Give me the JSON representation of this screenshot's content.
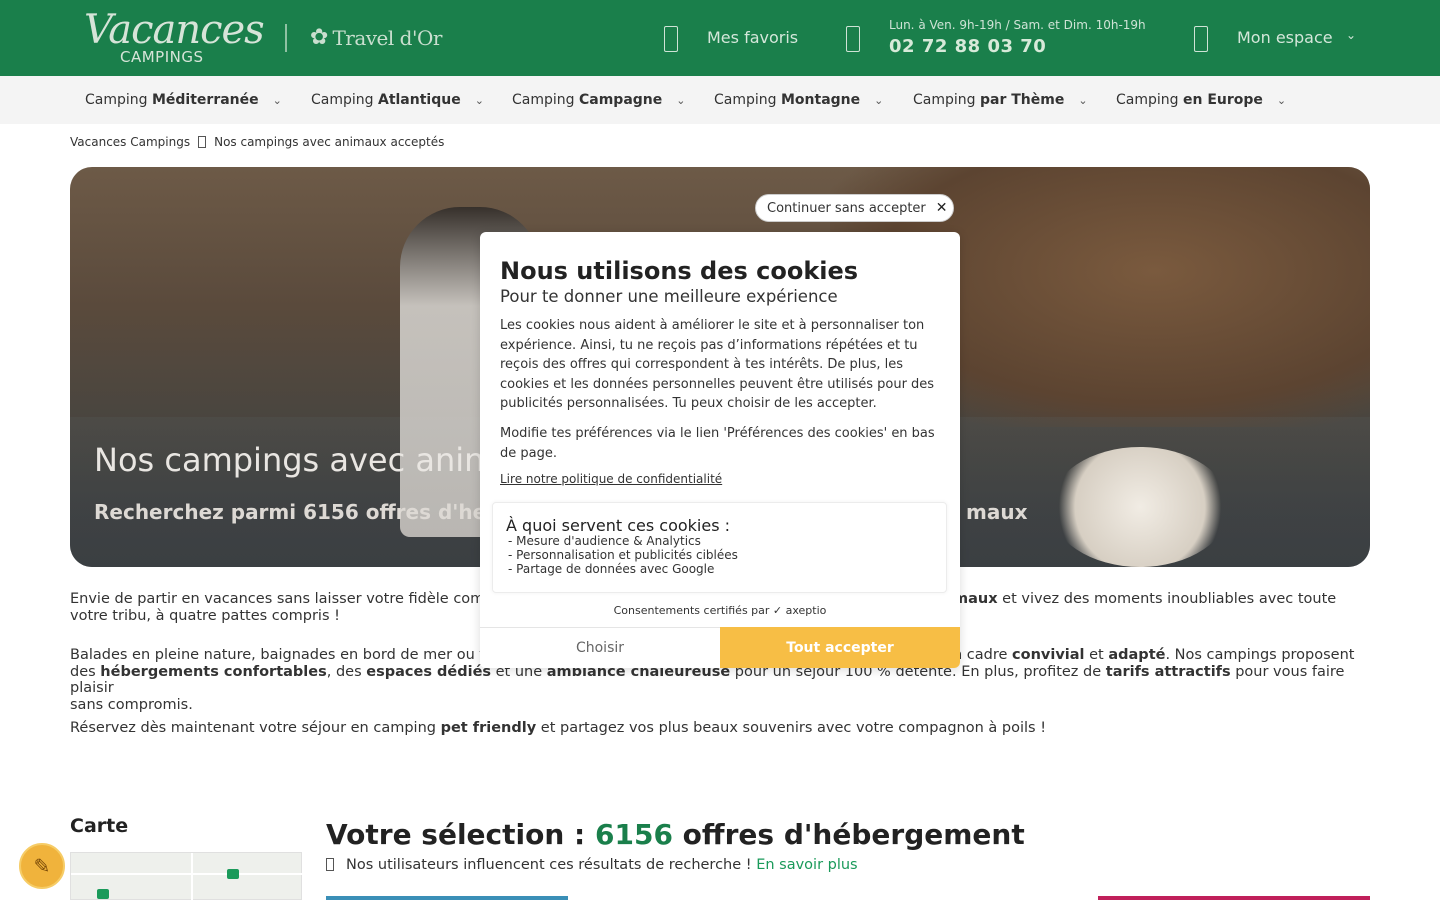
{
  "header": {
    "logo_main": "Vacances",
    "logo_sub": "CAMPINGS",
    "partner_logo": "Travel d'Or",
    "favorites_label": "Mes favoris",
    "hours": "Lun. à Ven. 9h-19h / Sam. et Dim. 10h-19h",
    "phone": "02 72 88 03 70",
    "account_label": "Mon espace",
    "bg_color": "#1a7f4b"
  },
  "nav": [
    {
      "prefix": "Camping",
      "bold": "Méditerranée"
    },
    {
      "prefix": "Camping",
      "bold": "Atlantique"
    },
    {
      "prefix": "Camping",
      "bold": "Campagne"
    },
    {
      "prefix": "Camping",
      "bold": "Montagne"
    },
    {
      "prefix": "Camping",
      "bold": "par Thème"
    },
    {
      "prefix": "Camping",
      "bold": "en Europe"
    }
  ],
  "breadcrumb": {
    "home": "Vacances Campings",
    "current": "Nos campings avec animaux acceptés"
  },
  "hero": {
    "title": "Nos campings avec anin",
    "subtitle": "Recherchez parmi 6156 offres d'he",
    "subtitle_end": "maux"
  },
  "intro": {
    "p1_a": "Envie de partir en vacances sans laisser votre fidèle comp",
    "p1_bold": "maux",
    "p1_b": " et vivez des moments inoubliables avec toute",
    "p1_c": "votre tribu, à quatre pattes compris !",
    "p2_a": "Balades en pleine nature, baignades en bord de mer ou fa",
    "p2_b": "n cadre ",
    "p2_bold1": "convivial",
    "p2_c": " et ",
    "p2_bold2": "adapté",
    "p2_d": ". Nos campings proposent",
    "p2_e": "des ",
    "p2_bold3": "hébergements confortables",
    "p2_f": ", des ",
    "p2_bold4": "espaces dédiés",
    "p2_g": " et une ",
    "p2_bold5": "ambiance chaleureuse",
    "p2_h": " pour un séjour 100 % détente. En plus, profitez de ",
    "p2_bold6": "tarifs attractifs",
    "p2_i": " pour vous faire plaisir",
    "p2_j": "sans compromis.",
    "p3_a": "Réservez dès maintenant votre séjour en camping ",
    "p3_bold": "pet friendly",
    "p3_b": " et partagez vos plus beaux souvenirs avec votre compagnon à poils !"
  },
  "results": {
    "map_label": "Carte",
    "title_prefix": "Votre sélection : ",
    "count": "6156",
    "title_suffix": " offres d'hébergement",
    "info_text": "Nos utilisateurs influencent ces résultats de recherche ! ",
    "info_link": "En savoir plus"
  },
  "cookie_modal": {
    "continue_label": "Continuer sans accepter",
    "title": "Nous utilisons des cookies",
    "subtitle": "Pour te donner une meilleure expérience",
    "body": "Les cookies nous aident à améliorer le site et à personnaliser ton expérience. Ainsi, tu ne reçois pas d’informations répétées et tu reçois des offres qui correspondent à tes intérêts. De plus, les cookies et les données personnelles peuvent être utilisés pour des publicités personnalisées. Tu peux choisir de les accepter.",
    "body2": "Modifie tes préférences via le lien 'Préférences des cookies' en bas de page.",
    "privacy_link": "Lire notre politique de confidentialité",
    "purposes_title": "À quoi servent ces cookies :",
    "purposes": [
      "- Mesure d'audience & Analytics",
      "- Personnalisation et publicités ciblées",
      "- Partage de données avec Google"
    ],
    "certified": "Consentements certifiés par ✓ axeptio",
    "choose_label": "Choisir",
    "accept_label": "Tout accepter",
    "accept_color": "#f7be45"
  }
}
